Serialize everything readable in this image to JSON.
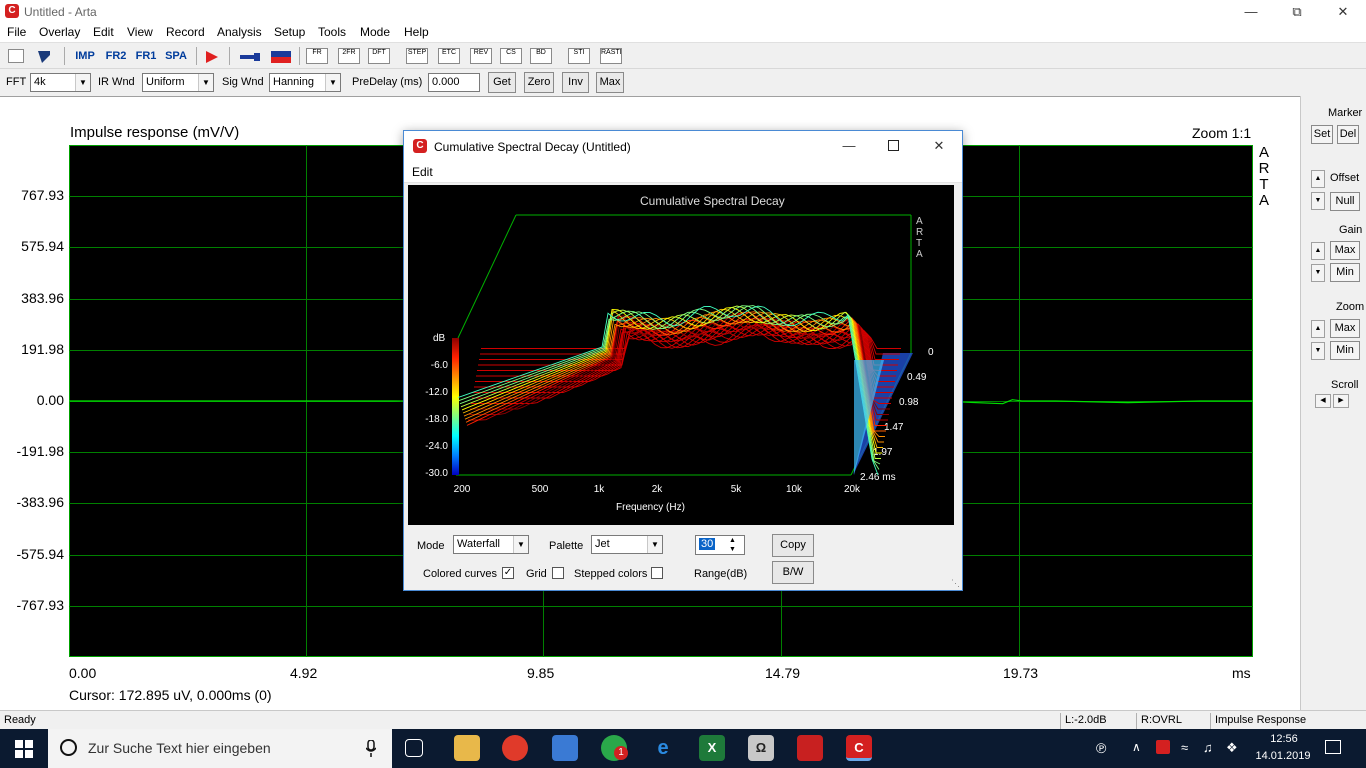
{
  "window": {
    "title": "Untitled - Arta",
    "app_icon_letter": "C",
    "min": "—",
    "restore": "⧉",
    "close": "✕"
  },
  "menu": [
    "File",
    "Overlay",
    "Edit",
    "View",
    "Record",
    "Analysis",
    "Setup",
    "Tools",
    "Mode",
    "Help"
  ],
  "toolbar": {
    "new_icon": "document-icon",
    "open_icon": "arrow-icon",
    "imp": "IMP",
    "fr2": "FR2",
    "fr1": "FR1",
    "spa": "SPA",
    "play_icon": "red-triangle-play-icon",
    "gen1": "generator-icon",
    "gen2": "signal-icon",
    "icon_labels": [
      "FR",
      "2FR",
      "DFT",
      "STEP",
      "ETC",
      "REV",
      "CS",
      "BD",
      "STI",
      "RASTI"
    ]
  },
  "params": {
    "fft_label": "FFT",
    "fft_value": "4k",
    "irwnd_label": "IR Wnd",
    "irwnd_value": "Uniform",
    "sigwnd_label": "Sig Wnd",
    "sigwnd_value": "Hanning",
    "predelay_label": "PreDelay (ms)",
    "predelay_value": "0.000",
    "get": "Get",
    "zero": "Zero",
    "inv": "Inv",
    "max": "Max"
  },
  "chart_data": {
    "type": "line",
    "title": "Impulse response (mV/V)",
    "zoom_label": "Zoom 1:1",
    "watermark": [
      "A",
      "R",
      "T",
      "A"
    ],
    "xlabel": "ms",
    "x_ticks": [
      "0.00",
      "4.92",
      "9.85",
      "14.79",
      "19.73"
    ],
    "y_ticks": [
      "767.93",
      "575.94",
      "383.96",
      "191.98",
      "0.00",
      "-191.98",
      "-383.96",
      "-575.94",
      "-767.93"
    ],
    "xlim": [
      0,
      24.6
    ],
    "ylim": [
      -959.91,
      959.91
    ],
    "grid": true,
    "series_color": "#00e000",
    "series": [
      {
        "x": [
          0,
          7.55,
          7.6,
          7.65,
          7.7,
          7.75,
          7.8,
          7.85,
          7.9,
          7.95,
          8.0,
          8.1,
          8.2,
          8.3,
          8.5,
          8.8,
          9.2,
          10,
          12,
          15,
          18,
          19.4,
          19.6,
          19.8,
          20.5,
          22,
          23.5,
          24.6
        ],
        "y": [
          0,
          0,
          240,
          -230,
          120,
          -150,
          80,
          -60,
          40,
          -30,
          20,
          30,
          -10,
          10,
          5,
          0,
          0,
          0,
          0,
          0,
          0,
          -10,
          5,
          0,
          0,
          -6,
          0,
          0
        ]
      }
    ],
    "cursor_text": "Cursor: 172.895 uV, 0.000ms (0)"
  },
  "right_panel": {
    "marker": "Marker",
    "set": "Set",
    "del": "Del",
    "offset": "Offset",
    "null": "Null",
    "gain": "Gain",
    "gain_max": "Max",
    "gain_min": "Min",
    "zoom": "Zoom",
    "zoom_max": "Max",
    "zoom_min": "Min",
    "scroll": "Scroll"
  },
  "status": {
    "ready": "Ready",
    "left": "L:-2.0dB",
    "right": "R:OVRL",
    "mode": "Impulse Response"
  },
  "csd_dialog": {
    "title": "Cumulative Spectral Decay  (Untitled)",
    "menu_edit": "Edit",
    "plot_title": "Cumulative Spectral Decay",
    "watermark": [
      "A",
      "R",
      "T",
      "A"
    ],
    "db_label": "dB",
    "db_ticks": [
      "-6.0",
      "-12.0",
      "-18.0",
      "-24.0",
      "-30.0"
    ],
    "freq_ticks": [
      "200",
      "500",
      "1k",
      "2k",
      "5k",
      "10k",
      "20k"
    ],
    "xlabel": "Frequency (Hz)",
    "time_ticks": [
      "0",
      "0.49",
      "0.98",
      "1.47",
      "1.97",
      "2.46 ms"
    ],
    "mode_label": "Mode",
    "mode_value": "Waterfall",
    "palette_label": "Palette",
    "palette_value": "Jet",
    "range_value": "30",
    "range_label": "Range(dB)",
    "copy": "Copy",
    "bw": "B/W",
    "colored_curves": "Colored curves",
    "grid": "Grid",
    "stepped_colors": "Stepped colors"
  },
  "taskbar": {
    "search_placeholder": "Zur Suche Text hier eingeben",
    "time": "12:56",
    "date": "14.01.2019",
    "badge": "1"
  }
}
